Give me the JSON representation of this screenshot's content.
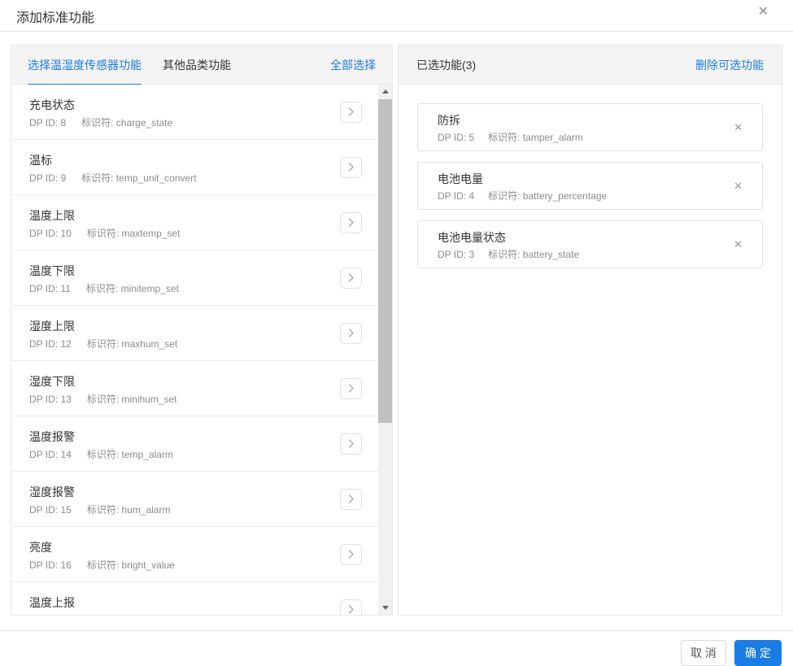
{
  "colors": {
    "accent": "#1a7ce5"
  },
  "dialog": {
    "title": "添加标准功能"
  },
  "icons": {
    "close": "✕",
    "remove": "✕"
  },
  "left_panel": {
    "tabs": [
      {
        "label": "选择温湿度传感器功能",
        "active": true
      },
      {
        "label": "其他品类功能",
        "active": false
      }
    ],
    "select_all": "全部选择",
    "items": [
      {
        "name": "充电状态",
        "dp_id": "DP ID: 8",
        "identifier": "标识符: charge_state"
      },
      {
        "name": "温标",
        "dp_id": "DP ID: 9",
        "identifier": "标识符: temp_unit_convert"
      },
      {
        "name": "温度上限",
        "dp_id": "DP ID: 10",
        "identifier": "标识符: maxtemp_set"
      },
      {
        "name": "温度下限",
        "dp_id": "DP ID: 11",
        "identifier": "标识符: minitemp_set"
      },
      {
        "name": "湿度上限",
        "dp_id": "DP ID: 12",
        "identifier": "标识符: maxhum_set"
      },
      {
        "name": "湿度下限",
        "dp_id": "DP ID: 13",
        "identifier": "标识符: minihum_set"
      },
      {
        "name": "温度报警",
        "dp_id": "DP ID: 14",
        "identifier": "标识符: temp_alarm"
      },
      {
        "name": "湿度报警",
        "dp_id": "DP ID: 15",
        "identifier": "标识符: hum_alarm"
      },
      {
        "name": "亮度",
        "dp_id": "DP ID: 16",
        "identifier": "标识符: bright_value"
      },
      {
        "name": "温度上报"
      }
    ]
  },
  "right_panel": {
    "title": "已选功能(3)",
    "delete_link": "删除可选功能",
    "cards": [
      {
        "name": "防拆",
        "dp_id": "DP ID: 5",
        "identifier": "标识符: tamper_alarm"
      },
      {
        "name": "电池电量",
        "dp_id": "DP ID: 4",
        "identifier": "标识符: battery_percentage"
      },
      {
        "name": "电池电量状态",
        "dp_id": "DP ID: 3",
        "identifier": "标识符: battery_state"
      }
    ]
  },
  "footer": {
    "cancel": "取 消",
    "confirm": "确 定"
  }
}
